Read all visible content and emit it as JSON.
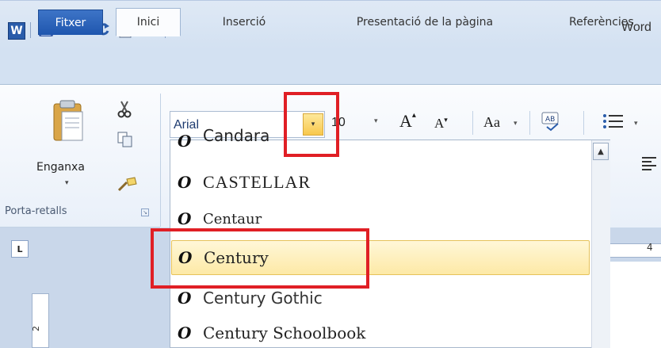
{
  "app": {
    "title": "Word",
    "logo_letter": "W"
  },
  "tabs": {
    "file": "Fitxer",
    "home": "Inici",
    "insert": "Inserció",
    "layout": "Presentació de la pàgina",
    "references": "Referències"
  },
  "clipboard": {
    "paste_label": "Enganxa",
    "group_label": "Porta-retalls"
  },
  "font": {
    "name_value": "Arial",
    "size_value": "10",
    "grow_label": "A",
    "shrink_label": "A",
    "case_label": "Aa"
  },
  "font_list": {
    "icon_glyph": "O",
    "items": [
      {
        "name": "Candara"
      },
      {
        "name": "CASTELLAR"
      },
      {
        "name": "Centaur"
      },
      {
        "name": "Century",
        "selected": true
      },
      {
        "name": "Century Gothic"
      },
      {
        "name": "Century Schoolbook"
      }
    ]
  },
  "ruler": {
    "corner_label": "L",
    "vertical_number": "2",
    "horizontal_number": "4"
  },
  "colors": {
    "accent": "#2a5caa",
    "highlight": "#fde9a6",
    "annotation": "#e01f25"
  }
}
